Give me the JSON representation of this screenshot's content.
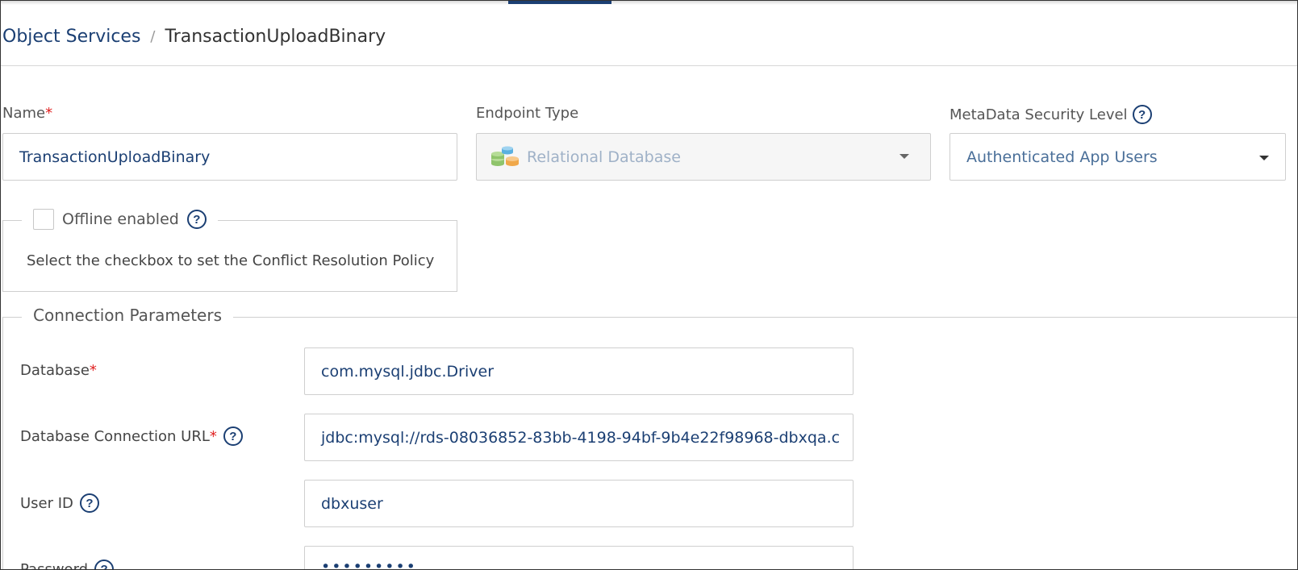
{
  "breadcrumb": {
    "parent": "Object Services",
    "separator": "/",
    "current": "TransactionUploadBinary"
  },
  "form": {
    "name": {
      "label": "Name",
      "required_mark": "*",
      "value": "TransactionUploadBinary"
    },
    "endpoint_type": {
      "label": "Endpoint Type",
      "value": "Relational Database",
      "icon": "database-icon"
    },
    "metadata_security": {
      "label": "MetaData Security Level",
      "value": "Authenticated App Users"
    },
    "offline": {
      "label": "Offline enabled",
      "checked": false,
      "hint": "Select the checkbox to set the Conflict Resolution Policy"
    }
  },
  "connection": {
    "legend": "Connection Parameters",
    "database": {
      "label": "Database",
      "required_mark": "*",
      "value": "com.mysql.jdbc.Driver"
    },
    "url": {
      "label": "Database Connection URL",
      "required_mark": "*",
      "value": "jdbc:mysql://rds-08036852-83bb-4198-94bf-9b4e22f98968-dbxqa.c"
    },
    "user_id": {
      "label": "User ID",
      "value": "dbxuser"
    },
    "password": {
      "label": "Password",
      "value": "•••••••••"
    }
  },
  "icons": {
    "help": "?"
  },
  "colors": {
    "accent": "#1b3f73",
    "required": "#e02020",
    "border": "#cfcfcf"
  }
}
